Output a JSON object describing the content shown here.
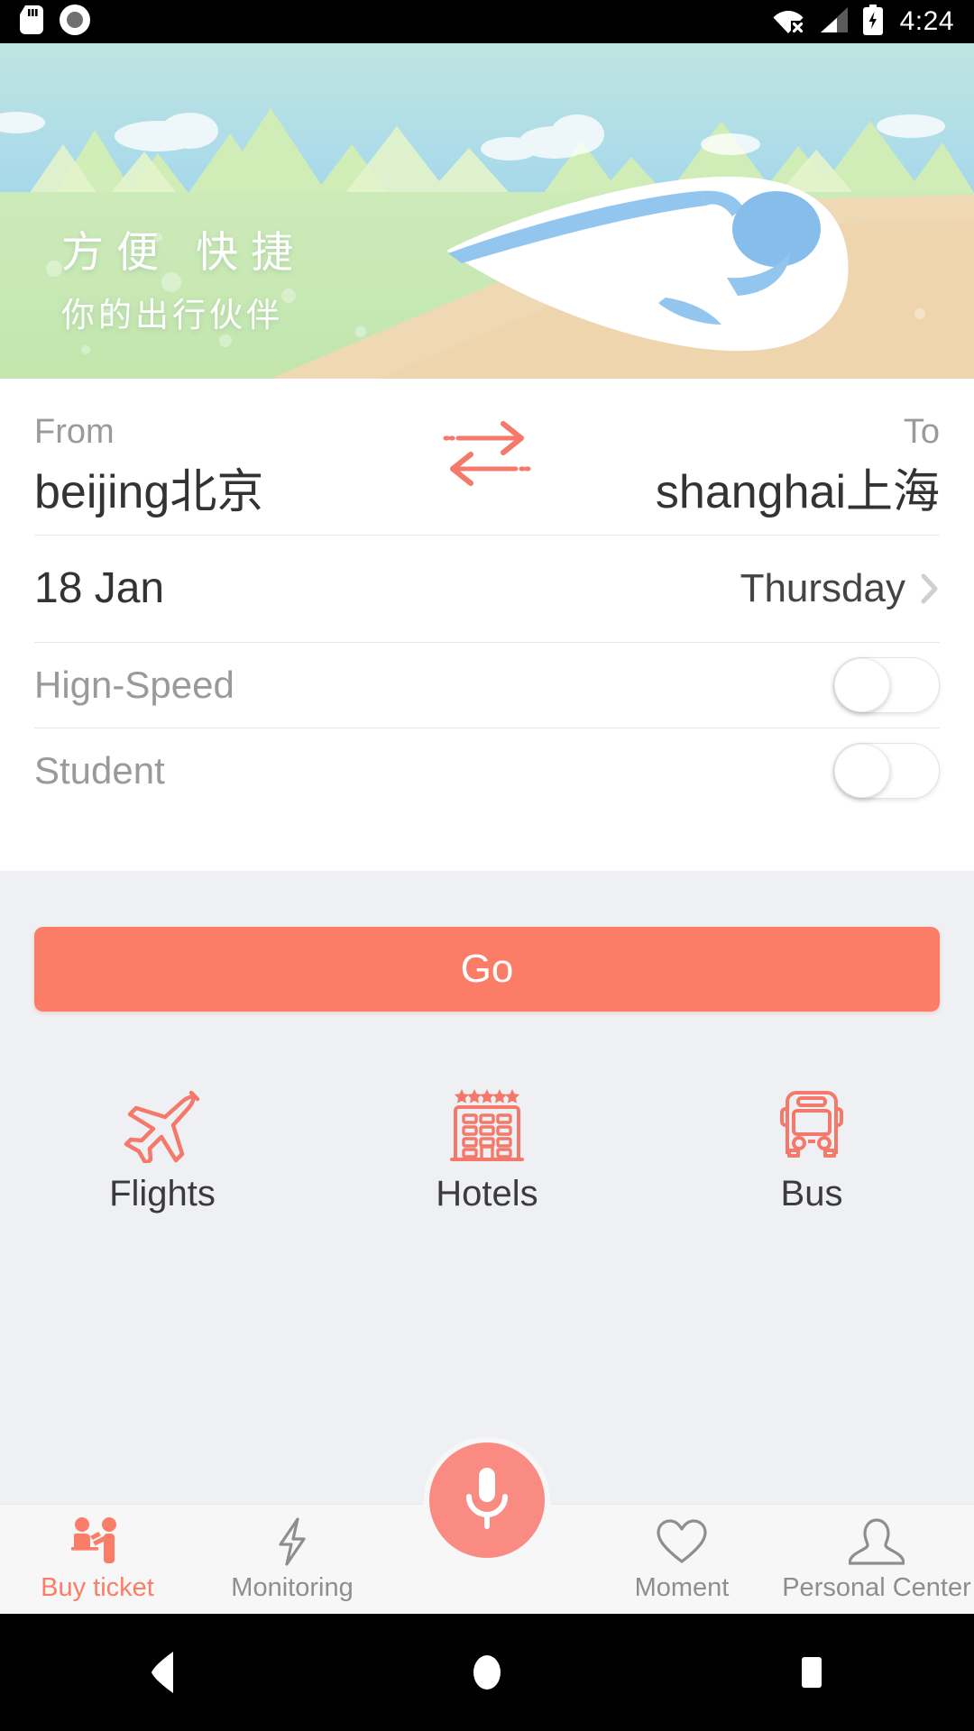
{
  "statusbar": {
    "time": "4:24",
    "icons": [
      "sd-card-icon",
      "camera-icon",
      "wifi-off-icon",
      "cellular-signal-icon",
      "battery-charging-icon"
    ]
  },
  "hero": {
    "title": "方便 快捷",
    "subtitle": "你的出行伙伴",
    "illustration": "high-speed-train-illustration"
  },
  "search": {
    "from_label": "From",
    "from_city": "beijing北京",
    "to_label": "To",
    "to_city": "shanghai上海",
    "swap_icon": "swap-arrows-icon",
    "date": "18 Jan",
    "weekday": "Thursday",
    "chevron_icon": "chevron-right-icon",
    "toggles": [
      {
        "label": "Hign-Speed",
        "value": "off",
        "name": "high-speed-toggle"
      },
      {
        "label": "Student",
        "value": "off",
        "name": "student-toggle"
      }
    ]
  },
  "actions": {
    "go_label": "Go",
    "accent_color": "#fb7d67"
  },
  "shortcuts": [
    {
      "label": "Flights",
      "icon": "airplane-icon"
    },
    {
      "label": "Hotels",
      "icon": "hotel-building-icon"
    },
    {
      "label": "Bus",
      "icon": "bus-icon"
    }
  ],
  "bottom_nav": {
    "items": [
      {
        "label": "Buy ticket",
        "icon": "ticket-counter-icon",
        "active": true
      },
      {
        "label": "Monitoring",
        "icon": "lightning-bolt-icon",
        "active": false
      },
      {
        "label": "Moment",
        "icon": "heart-icon",
        "active": false
      },
      {
        "label": "Personal Center",
        "icon": "person-icon",
        "active": false
      }
    ],
    "fab": {
      "icon": "microphone-icon",
      "color": "#f98b82"
    }
  },
  "android_nav": {
    "back": "back-triangle-icon",
    "home": "home-circle-icon",
    "recents": "recents-square-icon"
  }
}
